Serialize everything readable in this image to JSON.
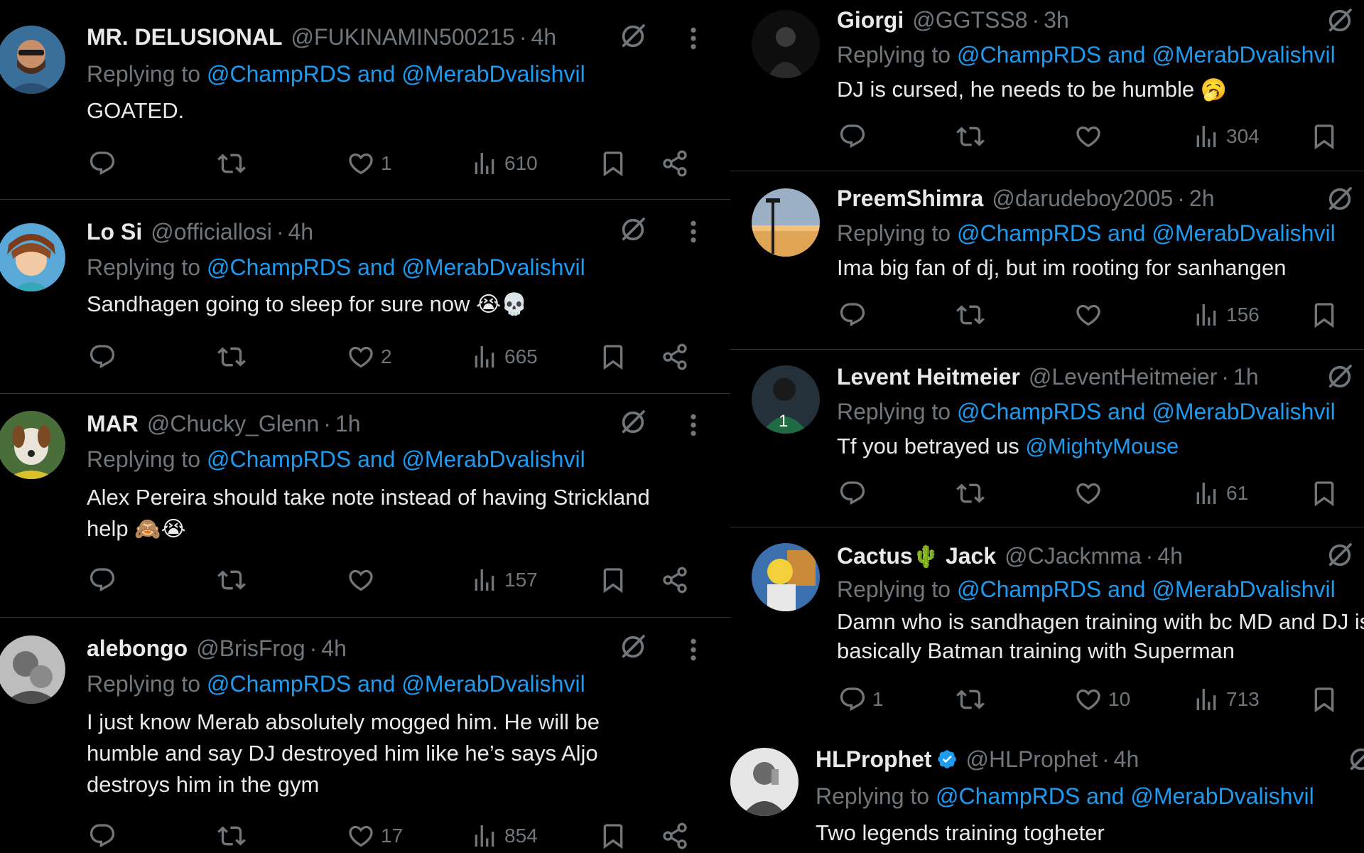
{
  "left_column": [
    {
      "name": "MR. DELUSIONAL",
      "handle": "@FUKINAMIN500215",
      "dot": "·",
      "time": "4h",
      "replying_label": "Replying to ",
      "replying_to": "@ChampRDS and @MerabDvalishvil",
      "body": "GOATED.",
      "replies": "",
      "reposts": "",
      "likes": "1",
      "views": "610"
    },
    {
      "name": "Lo Si",
      "handle": "@officiallosi",
      "dot": "·",
      "time": "4h",
      "replying_label": "Replying to ",
      "replying_to": "@ChampRDS and @MerabDvalishvil",
      "body": "Sandhagen going to sleep for sure now",
      "emoji": "😭💀",
      "replies": "",
      "reposts": "",
      "likes": "2",
      "views": "665"
    },
    {
      "name": "MAR",
      "handle": "@Chucky_Glenn",
      "dot": "·",
      "time": "1h",
      "replying_label": "Replying to ",
      "replying_to": "@ChampRDS and @MerabDvalishvil",
      "body_line1": "Alex Pereira should take note instead of having Strickland",
      "body_line2": "help",
      "emoji": "🙈😭",
      "replies": "",
      "reposts": "",
      "likes": "",
      "views": "157"
    },
    {
      "name": "alebongo",
      "handle": "@BrisFrog",
      "dot": "·",
      "time": "4h",
      "replying_label": "Replying to ",
      "replying_to": "@ChampRDS and @MerabDvalishvil",
      "body_line1": "I just know Merab absolutely mogged him. He will be",
      "body_line2": "humble and say DJ destroyed him like he’s says Aljo",
      "body_line3": "destroys him in the gym",
      "replies": "",
      "reposts": "",
      "likes": "17",
      "views": "854"
    }
  ],
  "right_column": [
    {
      "name": "Giorgi",
      "handle": "@GGTSS8",
      "dot": "·",
      "time": "3h",
      "replying_label": "Replying to ",
      "replying_to": "@ChampRDS and @MerabDvalishvil",
      "body": "DJ is cursed, he needs to be humble",
      "emoji": "🥱",
      "replies": "",
      "reposts": "",
      "likes": "",
      "views": "304"
    },
    {
      "name": "PreemShimra",
      "handle": "@darudeboy2005",
      "dot": "·",
      "time": "2h",
      "replying_label": "Replying to ",
      "replying_to": "@ChampRDS and @MerabDvalishvil",
      "body": "Ima big fan of dj, but im rooting for sanhangen",
      "replies": "",
      "reposts": "",
      "likes": "",
      "views": "156"
    },
    {
      "name": "Levent Heitmeier",
      "handle": "@LeventHeitmeier",
      "dot": "·",
      "time": "1h",
      "replying_label": "Replying to ",
      "replying_to": "@ChampRDS and @MerabDvalishvil",
      "body": "Tf you betrayed us ",
      "body_mention": "@MightyMouse",
      "replies": "",
      "reposts": "",
      "likes": "",
      "views": "61"
    },
    {
      "name_part1": "Cactus",
      "name_emoji": "🌵",
      "name_part2": "Jack",
      "handle": "@CJackmma",
      "dot": "·",
      "time": "4h",
      "replying_label": "Replying to ",
      "replying_to": "@ChampRDS and @MerabDvalishvil",
      "body_line1": "Damn who is sandhagen training with bc MD and DJ is",
      "body_line2": "basically Batman training with Superman",
      "replies": "1",
      "reposts": "",
      "likes": "10",
      "views": "713"
    },
    {
      "name": "HLProphet",
      "handle": "@HLProphet",
      "dot": "·",
      "time": "4h",
      "replying_label": "Replying to ",
      "replying_to": "@ChampRDS and @MerabDvalishvil",
      "body": "Two legends training togheter"
    }
  ],
  "icons": {
    "reply": "reply-icon",
    "repost": "repost-icon",
    "like": "heart-icon",
    "views": "views-icon",
    "bookmark": "bookmark-icon",
    "share": "share-icon",
    "grok": "grok-icon",
    "more": "more-icon",
    "verified": "verified-badge-icon"
  },
  "colors": {
    "background": "#000000",
    "text": "#e7e9ea",
    "muted": "#71767b",
    "link": "#1d9bf0",
    "divider": "#2f3336"
  }
}
